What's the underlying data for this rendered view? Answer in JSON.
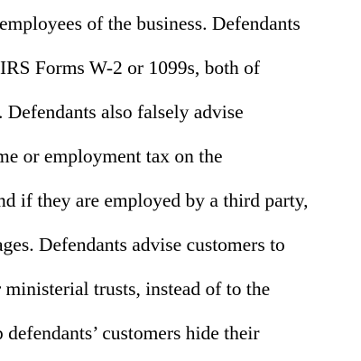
{
  "document": {
    "lines": [
      "employees of the business.  Defendants",
      " IRS Forms W-2 or 1099s, both of",
      ".  Defendants also falsely advise",
      "me or employment tax on the",
      "nd if they are employed by a third party,",
      "ages.  Defendants advise customers to",
      "r ministerial trusts, instead of to the",
      "p defendants’ customers hide their"
    ]
  }
}
